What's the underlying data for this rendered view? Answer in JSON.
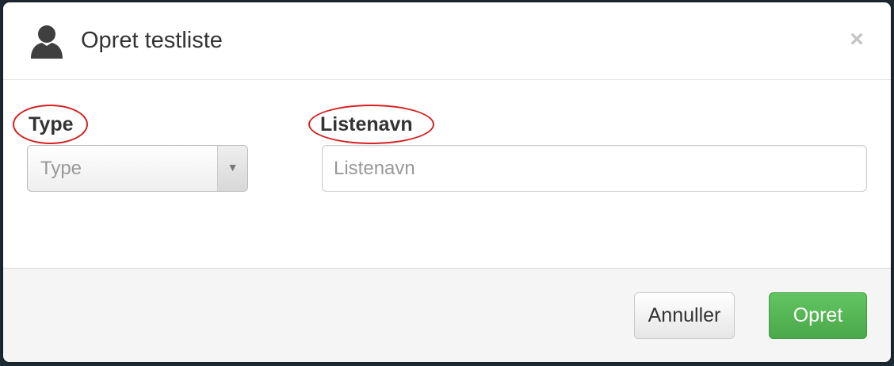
{
  "dialog": {
    "title": "Opret testliste",
    "header_icon": "user-icon",
    "close_symbol": "×"
  },
  "form": {
    "type": {
      "label": "Type",
      "placeholder": "Type",
      "arrow_symbol": "▼"
    },
    "listenavn": {
      "label": "Listenavn",
      "placeholder": "Listenavn",
      "value": ""
    }
  },
  "footer": {
    "cancel_label": "Annuller",
    "create_label": "Opret"
  },
  "colors": {
    "primary_green": "#5bb75b",
    "annotation_red": "#d61f1f"
  }
}
